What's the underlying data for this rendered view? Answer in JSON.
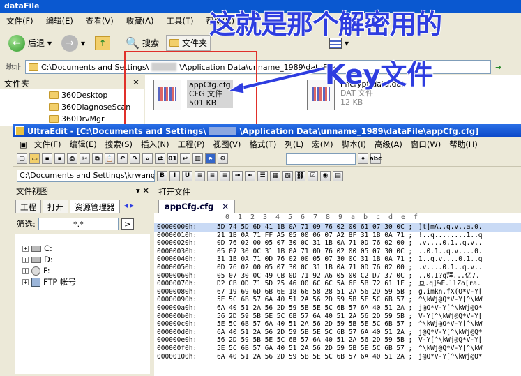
{
  "explorer": {
    "title": "dataFile",
    "menu": [
      "文件(F)",
      "编辑(E)",
      "查看(V)",
      "收藏(A)",
      "工具(T)",
      "帮助(H)"
    ],
    "back_label": "后退",
    "search_label": "搜索",
    "folders_label": "文件夹",
    "address_label": "地址",
    "address_value": "C:\\Documents and Settings\\",
    "address_value_tail": "\\Application Data\\unname_1989\\dataFile",
    "go_label": "",
    "folder_pane_title": "文件夹",
    "tree": [
      "360Desktop",
      "360DiagnoseScan",
      "360DrvMgr"
    ],
    "files": [
      {
        "name": "appCfg.cfg",
        "type": "CFG 文件",
        "size": "501 KB"
      },
      {
        "name": "Pncrypt.data.dat",
        "type": "DAT 文件",
        "size": "12 KB"
      }
    ]
  },
  "annotation": {
    "line1": "这就是那个解密用的",
    "line2": "Key文件",
    "color": "#2e3de0",
    "box_color": "#e0302a"
  },
  "ultraedit": {
    "title": "UltraEdit - [C:\\Documents and Settings\\",
    "title_tail": "\\Application Data\\unname_1989\\dataFile\\appCfg.cfg]",
    "menu": [
      "文件(F)",
      "编辑(E)",
      "搜索(S)",
      "插入(N)",
      "工程(P)",
      "视图(V)",
      "格式(T)",
      "列(L)",
      "宏(M)",
      "脚本(I)",
      "高级(A)",
      "窗口(W)",
      "帮助(H)"
    ],
    "path_combo": "C:\\Documents and Settings\\krwang\\A",
    "file_view_title": "文件视图",
    "file_view_controls": "▾ ✕",
    "tabs": [
      "工程",
      "打开",
      "资源管理器"
    ],
    "filter_label": "筛选:",
    "filter_value": "*.*",
    "drives": [
      "C:",
      "D:",
      "F:",
      "FTP 帐号"
    ],
    "open_files_title": "打开文件",
    "doc_tab": "appCfg.cfg",
    "hex_header": [
      "0",
      "1",
      "2",
      "3",
      "4",
      "5",
      "6",
      "7",
      "8",
      "9",
      "a",
      "b",
      "c",
      "d",
      "e",
      "f"
    ],
    "hex_rows": [
      {
        "off": "00000000h:",
        "bytes": "5D 74 5D 6D 41 1B 0A 71 09 76 02 00 61 07 30 0C ;",
        "ascii": "]t]mA..q.v..a.0."
      },
      {
        "off": "00000010h:",
        "bytes": "21 1B 0A 71 FF A5 05 00 06 07 A2 8F 31 1B 0A 71 ;",
        "ascii": "!..q........1..q"
      },
      {
        "off": "00000020h:",
        "bytes": "0D 76 02 00 05 07 30 0C 31 1B 0A 71 0D 76 02 00 ;",
        "ascii": ".v....0.1..q.v.."
      },
      {
        "off": "00000030h:",
        "bytes": "05 07 30 0C 31 1B 0A 71 0D 76 02 00 05 07 30 0C ;",
        "ascii": "..0.1..q.v....0."
      },
      {
        "off": "00000040h:",
        "bytes": "31 1B 0A 71 0D 76 02 00 05 07 30 0C 31 1B 0A 71 ;",
        "ascii": "1..q.v....0.1..q"
      },
      {
        "off": "00000050h:",
        "bytes": "0D 76 02 00 05 07 30 0C 31 1B 0A 71 0D 76 02 00 ;",
        "ascii": ".v....0.1..q.v.."
      },
      {
        "off": "00000060h:",
        "bytes": "05 07 30 0C 49 CB 0D 71 92 A6 05 00 C2 D7 37 0C ;",
        "ascii": "..0.I?q拜...亿7."
      },
      {
        "off": "00000070h:",
        "bytes": "D2 CB 0D 71 5D 25 46 00 6C 6C 5A 6F 5B 72 61 1F ;",
        "ascii": "亘.q]%F.llZo[ra."
      },
      {
        "off": "00000080h:",
        "bytes": "67 19 69 6D 6B 6E 18 66 58 28 51 2A 56 2D 59 5B ;",
        "ascii": "g.imkn.fX(Q*V-Y["
      },
      {
        "off": "00000090h:",
        "bytes": "5E 5C 6B 57 6A 40 51 2A 56 2D 59 5B 5E 5C 6B 57 ;",
        "ascii": "^\\kWj@Q*V-Y[^\\kW"
      },
      {
        "off": "000000a0h:",
        "bytes": "6A 40 51 2A 56 2D 59 5B 5E 5C 6B 57 6A 40 51 2A ;",
        "ascii": "j@Q*V-Y[^\\kWj@Q*"
      },
      {
        "off": "000000b0h:",
        "bytes": "56 2D 59 5B 5E 5C 6B 57 6A 40 51 2A 56 2D 59 5B ;",
        "ascii": "V-Y[^\\kWj@Q*V-Y["
      },
      {
        "off": "000000c0h:",
        "bytes": "5E 5C 6B 57 6A 40 51 2A 56 2D 59 5B 5E 5C 6B 57 ;",
        "ascii": "^\\kWj@Q*V-Y[^\\kW"
      },
      {
        "off": "000000d0h:",
        "bytes": "6A 40 51 2A 56 2D 59 5B 5E 5C 6B 57 6A 40 51 2A ;",
        "ascii": "j@Q*V-Y[^\\kWj@Q*"
      },
      {
        "off": "000000e0h:",
        "bytes": "56 2D 59 5B 5E 5C 6B 57 6A 40 51 2A 56 2D 59 5B ;",
        "ascii": "V-Y[^\\kWj@Q*V-Y["
      },
      {
        "off": "000000f0h:",
        "bytes": "5E 5C 6B 57 6A 40 51 2A 56 2D 59 5B 5E 5C 6B 57 ;",
        "ascii": "^\\kWj@Q*V-Y[^\\kW"
      },
      {
        "off": "00000100h:",
        "bytes": "6A 40 51 2A 56 2D 59 5B 5E 5C 6B 57 6A 40 51 2A ;",
        "ascii": "j@Q*V-Y[^\\kWj@Q*"
      }
    ]
  }
}
